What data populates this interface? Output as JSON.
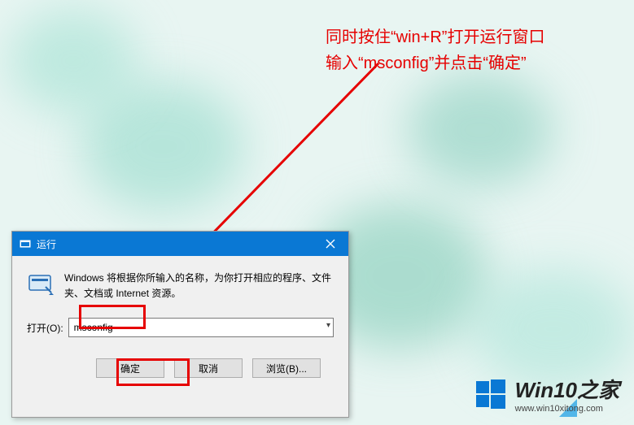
{
  "annotation": {
    "line1": "同时按住“win+R”打开运行窗口",
    "line2": "输入“msconfig”并点击“确定”"
  },
  "dialog": {
    "title": "运行",
    "description": "Windows 将根据你所输入的名称，为你打开相应的程序、文件夹、文档或 Internet 资源。",
    "open_label": "打开(O):",
    "input_value": "msconfig",
    "buttons": {
      "ok": "确定",
      "cancel": "取消",
      "browse": "浏览(B)..."
    }
  },
  "watermark": {
    "brand": "Win10之家",
    "url": "www.win10xitong.com"
  }
}
